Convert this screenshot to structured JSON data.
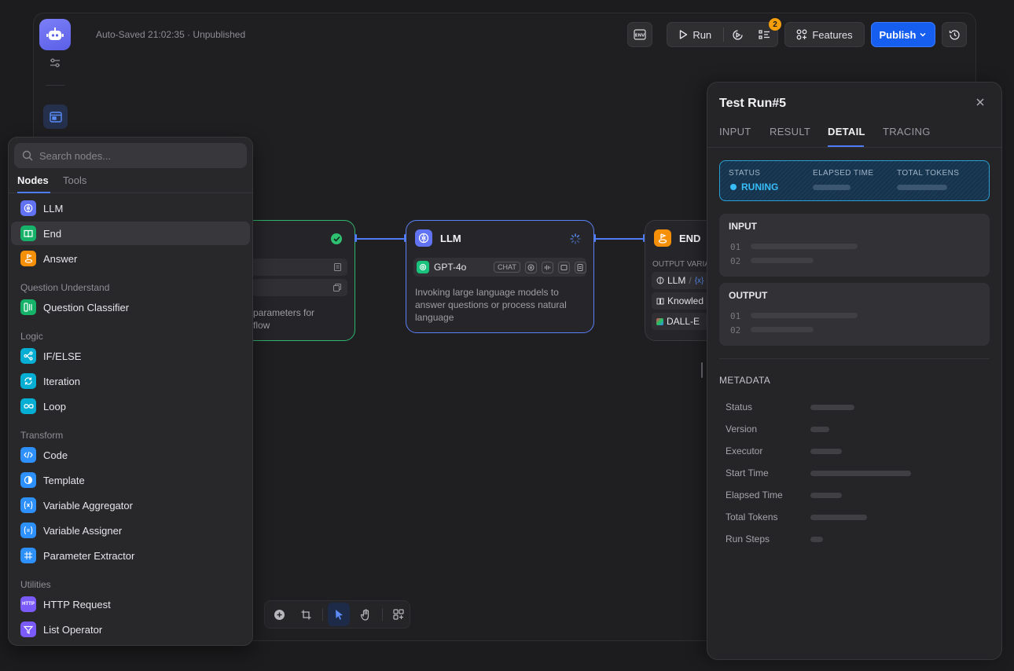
{
  "header": {
    "autosave": "Auto-Saved 21:02:35 · Unpublished",
    "env_label": "ENV",
    "run_label": "Run",
    "checklist_badge": "2",
    "features_label": "Features",
    "publish_label": "Publish"
  },
  "canvas": {
    "start_node": {
      "desc_line1": "parameters for",
      "desc_line2": "flow"
    },
    "llm_node": {
      "title": "LLM",
      "model": "GPT-4o",
      "mode_chip": "CHAT",
      "description": "Invoking large language models to answer questions or process natural language"
    },
    "end_node": {
      "title": "END",
      "output_label": "OUTPUT VARIA",
      "rows": [
        "LLM",
        "Knowled",
        "DALL-E"
      ],
      "var_glyph": "{x}"
    }
  },
  "nodes_panel": {
    "search_placeholder": "Search nodes...",
    "tabs": [
      "Nodes",
      "Tools"
    ],
    "items_top": [
      "LLM",
      "End",
      "Answer"
    ],
    "groups": [
      {
        "label": "Question Understand",
        "items": [
          "Question Classifier"
        ]
      },
      {
        "label": "Logic",
        "items": [
          "IF/ELSE",
          "Iteration",
          "Loop"
        ]
      },
      {
        "label": "Transform",
        "items": [
          "Code",
          "Template",
          "Variable Aggregator",
          "Variable Assigner",
          "Parameter Extractor"
        ]
      },
      {
        "label": "Utilities",
        "items": [
          "HTTP Request",
          "List Operator"
        ]
      }
    ],
    "http_glyph": "HTTP"
  },
  "run_panel": {
    "title": "Test Run#5",
    "tabs": [
      "INPUT",
      "RESULT",
      "DETAIL",
      "TRACING"
    ],
    "active_tab": "DETAIL",
    "status_label": "STATUS",
    "status_value": "RUNING",
    "elapsed_label": "ELAPSED TIME",
    "tokens_label": "TOTAL TOKENS",
    "input_title": "INPUT",
    "output_title": "OUTPUT",
    "line_numbers": [
      "01",
      "02"
    ],
    "metadata_title": "METADATA",
    "metadata_keys": [
      "Status",
      "Version",
      "Executor",
      "Start Time",
      "Elapsed Time",
      "Total Tokens",
      "Run Steps"
    ]
  },
  "colors": {
    "accent": "#155eef",
    "running": "#38bdf8",
    "success": "#2fbf71",
    "warning": "#f59e0b"
  },
  "icons": {
    "logo": "robot-icon",
    "close": "close-icon",
    "search": "search-icon"
  }
}
